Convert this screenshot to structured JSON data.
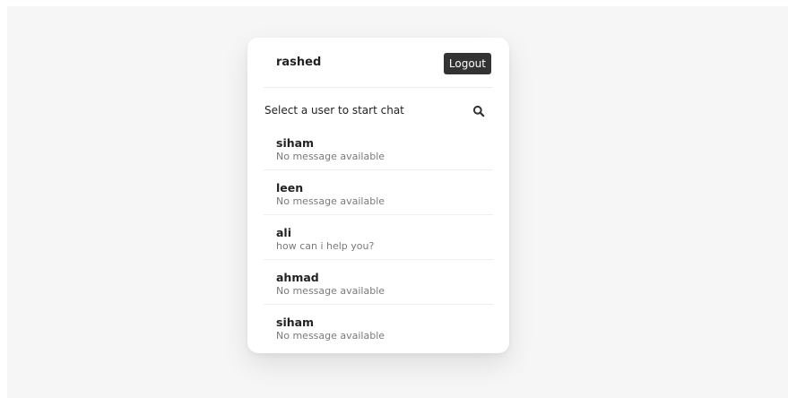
{
  "header": {
    "username": "rashed",
    "logout_label": "Logout"
  },
  "search": {
    "label": "Select a user to start chat",
    "icon": "search-icon"
  },
  "users": [
    {
      "name": "siham",
      "last_message": "No message available"
    },
    {
      "name": "leen",
      "last_message": "No message available"
    },
    {
      "name": "ali",
      "last_message": "how can i help you?"
    },
    {
      "name": "ahmad",
      "last_message": "No message available"
    },
    {
      "name": "siham",
      "last_message": "No message available"
    }
  ],
  "colors": {
    "background": "#f6f6f6",
    "card": "#ffffff",
    "button": "#333333"
  }
}
